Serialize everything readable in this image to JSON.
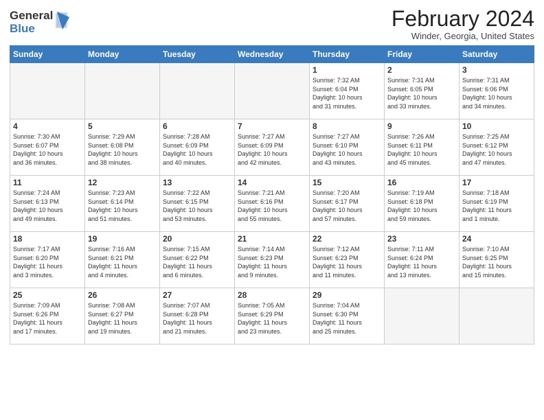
{
  "logo": {
    "general": "General",
    "blue": "Blue"
  },
  "title": "February 2024",
  "location": "Winder, Georgia, United States",
  "days_of_week": [
    "Sunday",
    "Monday",
    "Tuesday",
    "Wednesday",
    "Thursday",
    "Friday",
    "Saturday"
  ],
  "weeks": [
    [
      {
        "day": "",
        "info": ""
      },
      {
        "day": "",
        "info": ""
      },
      {
        "day": "",
        "info": ""
      },
      {
        "day": "",
        "info": ""
      },
      {
        "day": "1",
        "info": "Sunrise: 7:32 AM\nSunset: 6:04 PM\nDaylight: 10 hours\nand 31 minutes."
      },
      {
        "day": "2",
        "info": "Sunrise: 7:31 AM\nSunset: 6:05 PM\nDaylight: 10 hours\nand 33 minutes."
      },
      {
        "day": "3",
        "info": "Sunrise: 7:31 AM\nSunset: 6:06 PM\nDaylight: 10 hours\nand 34 minutes."
      }
    ],
    [
      {
        "day": "4",
        "info": "Sunrise: 7:30 AM\nSunset: 6:07 PM\nDaylight: 10 hours\nand 36 minutes."
      },
      {
        "day": "5",
        "info": "Sunrise: 7:29 AM\nSunset: 6:08 PM\nDaylight: 10 hours\nand 38 minutes."
      },
      {
        "day": "6",
        "info": "Sunrise: 7:28 AM\nSunset: 6:09 PM\nDaylight: 10 hours\nand 40 minutes."
      },
      {
        "day": "7",
        "info": "Sunrise: 7:27 AM\nSunset: 6:09 PM\nDaylight: 10 hours\nand 42 minutes."
      },
      {
        "day": "8",
        "info": "Sunrise: 7:27 AM\nSunset: 6:10 PM\nDaylight: 10 hours\nand 43 minutes."
      },
      {
        "day": "9",
        "info": "Sunrise: 7:26 AM\nSunset: 6:11 PM\nDaylight: 10 hours\nand 45 minutes."
      },
      {
        "day": "10",
        "info": "Sunrise: 7:25 AM\nSunset: 6:12 PM\nDaylight: 10 hours\nand 47 minutes."
      }
    ],
    [
      {
        "day": "11",
        "info": "Sunrise: 7:24 AM\nSunset: 6:13 PM\nDaylight: 10 hours\nand 49 minutes."
      },
      {
        "day": "12",
        "info": "Sunrise: 7:23 AM\nSunset: 6:14 PM\nDaylight: 10 hours\nand 51 minutes."
      },
      {
        "day": "13",
        "info": "Sunrise: 7:22 AM\nSunset: 6:15 PM\nDaylight: 10 hours\nand 53 minutes."
      },
      {
        "day": "14",
        "info": "Sunrise: 7:21 AM\nSunset: 6:16 PM\nDaylight: 10 hours\nand 55 minutes."
      },
      {
        "day": "15",
        "info": "Sunrise: 7:20 AM\nSunset: 6:17 PM\nDaylight: 10 hours\nand 57 minutes."
      },
      {
        "day": "16",
        "info": "Sunrise: 7:19 AM\nSunset: 6:18 PM\nDaylight: 10 hours\nand 59 minutes."
      },
      {
        "day": "17",
        "info": "Sunrise: 7:18 AM\nSunset: 6:19 PM\nDaylight: 11 hours\nand 1 minute."
      }
    ],
    [
      {
        "day": "18",
        "info": "Sunrise: 7:17 AM\nSunset: 6:20 PM\nDaylight: 11 hours\nand 3 minutes."
      },
      {
        "day": "19",
        "info": "Sunrise: 7:16 AM\nSunset: 6:21 PM\nDaylight: 11 hours\nand 4 minutes."
      },
      {
        "day": "20",
        "info": "Sunrise: 7:15 AM\nSunset: 6:22 PM\nDaylight: 11 hours\nand 6 minutes."
      },
      {
        "day": "21",
        "info": "Sunrise: 7:14 AM\nSunset: 6:23 PM\nDaylight: 11 hours\nand 9 minutes."
      },
      {
        "day": "22",
        "info": "Sunrise: 7:12 AM\nSunset: 6:23 PM\nDaylight: 11 hours\nand 11 minutes."
      },
      {
        "day": "23",
        "info": "Sunrise: 7:11 AM\nSunset: 6:24 PM\nDaylight: 11 hours\nand 13 minutes."
      },
      {
        "day": "24",
        "info": "Sunrise: 7:10 AM\nSunset: 6:25 PM\nDaylight: 11 hours\nand 15 minutes."
      }
    ],
    [
      {
        "day": "25",
        "info": "Sunrise: 7:09 AM\nSunset: 6:26 PM\nDaylight: 11 hours\nand 17 minutes."
      },
      {
        "day": "26",
        "info": "Sunrise: 7:08 AM\nSunset: 6:27 PM\nDaylight: 11 hours\nand 19 minutes."
      },
      {
        "day": "27",
        "info": "Sunrise: 7:07 AM\nSunset: 6:28 PM\nDaylight: 11 hours\nand 21 minutes."
      },
      {
        "day": "28",
        "info": "Sunrise: 7:05 AM\nSunset: 6:29 PM\nDaylight: 11 hours\nand 23 minutes."
      },
      {
        "day": "29",
        "info": "Sunrise: 7:04 AM\nSunset: 6:30 PM\nDaylight: 11 hours\nand 25 minutes."
      },
      {
        "day": "",
        "info": ""
      },
      {
        "day": "",
        "info": ""
      }
    ]
  ]
}
